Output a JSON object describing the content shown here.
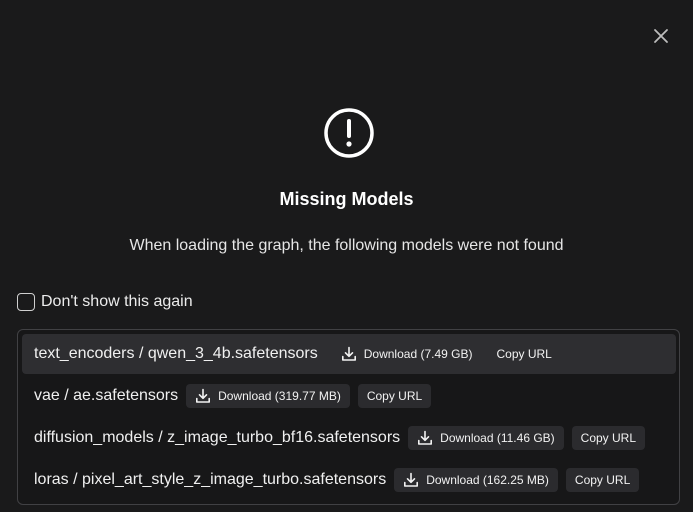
{
  "dialog": {
    "title": "Missing Models",
    "subtitle": "When loading the graph, the following models were not found",
    "dont_show_label": "Don't show this again",
    "dont_show_checked": false
  },
  "icons": {
    "close": "close-icon",
    "warning": "exclamation-circle-icon",
    "download": "download-icon"
  },
  "models": [
    {
      "name": "text_encoders / qwen_3_4b.safetensors",
      "download_label": "Download (7.49 GB)",
      "copy_label": "Copy URL"
    },
    {
      "name": "vae / ae.safetensors",
      "download_label": "Download (319.77 MB)",
      "copy_label": "Copy URL"
    },
    {
      "name": "diffusion_models / z_image_turbo_bf16.safetensors",
      "download_label": "Download (11.46 GB)",
      "copy_label": "Copy URL"
    },
    {
      "name": "loras / pixel_art_style_z_image_turbo.safetensors",
      "download_label": "Download (162.25 MB)",
      "copy_label": "Copy URL"
    }
  ],
  "colors": {
    "background": "#1a1a1b",
    "row_highlight": "#2e2e31",
    "button": "#2b2b2e",
    "border": "#414144"
  }
}
